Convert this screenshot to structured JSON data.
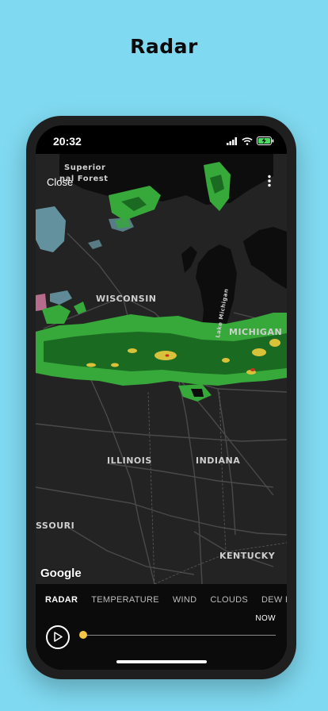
{
  "page": {
    "title": "Radar"
  },
  "status_bar": {
    "time": "20:32"
  },
  "map": {
    "close_label": "Close",
    "attribution": "Google",
    "labels": {
      "superior_1": "Superior",
      "superior_2": "nal Forest",
      "wisconsin": "WISCONSIN",
      "michigan": "MICHIGAN",
      "lake_michigan": "Lake Michigan",
      "illinois": "ILLINOIS",
      "indiana": "INDIANA",
      "missouri": "SSOURI",
      "kentucky": "KENTUCKY"
    }
  },
  "panel": {
    "tabs": [
      "RADAR",
      "TEMPERATURE",
      "WIND",
      "CLOUDS",
      "DEW POINT"
    ],
    "active_tab": "RADAR",
    "now_label": "NOW",
    "timeline_position": 0
  },
  "colors": {
    "background": "#7fd9f0",
    "map_land": "#232323",
    "water": "#0d0d0d",
    "radar_light": "#37a83a",
    "radar_dark": "#1a6a22",
    "radar_yellow": "#d8c23a",
    "radar_red": "#c8331f",
    "snow_blue": "#7ab8c8",
    "handle": "#f6c443"
  },
  "icons": {
    "status": [
      "cellular-signal-icon",
      "wifi-icon",
      "battery-charging-icon"
    ],
    "map": [
      "more-vertical-icon"
    ],
    "panel": [
      "play-icon"
    ]
  }
}
